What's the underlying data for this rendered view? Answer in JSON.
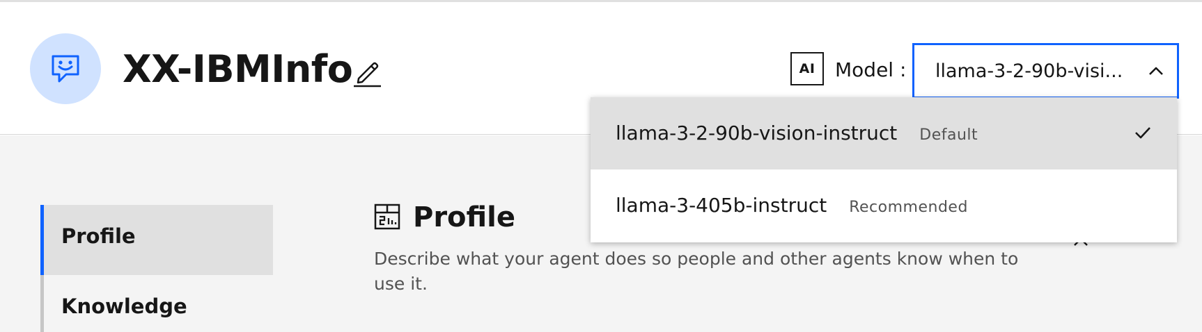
{
  "agent": {
    "name": "XX-IBMInfo",
    "avatar_icon": "chat-bot-icon",
    "avatar_color": "#d0e2ff"
  },
  "model": {
    "badge": "AI",
    "label": "Model :",
    "selected_value": "llama-3-2-90b-visi...",
    "accent_color": "#0f62fe",
    "options": [
      {
        "name": "llama-3-2-90b-vision-instruct",
        "tag": "Default",
        "selected": true
      },
      {
        "name": "llama-3-405b-instruct",
        "tag": "Recommended",
        "selected": false
      }
    ]
  },
  "sidebar": {
    "items": [
      {
        "label": "Profile",
        "active": true
      },
      {
        "label": "Knowledge",
        "active": false
      }
    ]
  },
  "section": {
    "title": "Profile",
    "icon": "profile-card-icon",
    "description": "Describe what your agent does so people and other agents know when to use it."
  }
}
